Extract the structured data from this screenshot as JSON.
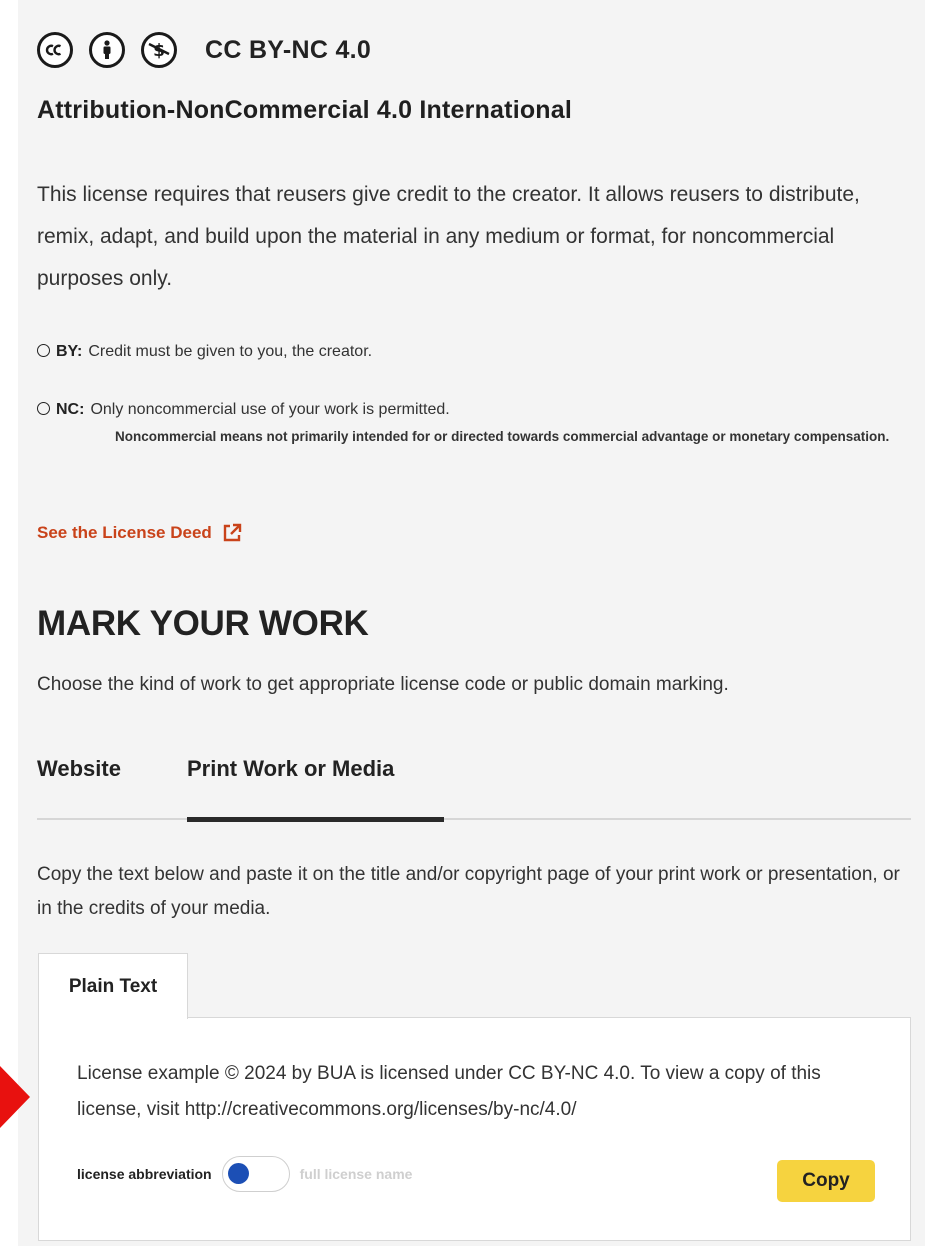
{
  "license": {
    "short_name": "CC BY-NC 4.0",
    "full_name": "Attribution-NonCommercial 4.0 International",
    "description": "This license requires that reusers give credit to the creator. It allows reusers to distribute, remix, adapt, and build upon the material in any medium or format, for noncommercial purposes only.",
    "icons": [
      "cc-icon",
      "by-person-icon",
      "nc-dollar-icon"
    ],
    "elements": [
      {
        "code": "BY:",
        "icon": "by-icon",
        "text": "Credit must be given to you, the creator.",
        "note": ""
      },
      {
        "code": "NC:",
        "icon": "nc-icon",
        "text": "Only noncommercial use of your work is permitted.",
        "note": "Noncommercial means not primarily intended for or directed towards commercial advantage or monetary compensation."
      }
    ],
    "deed_link": "See the License Deed"
  },
  "mark": {
    "title": "MARK YOUR WORK",
    "subtitle": "Choose the kind of work to get appropriate license code or public domain marking.",
    "tabs": [
      {
        "label": "Website",
        "active": false
      },
      {
        "label": "Print Work or Media",
        "active": true
      }
    ],
    "instructions": "Copy the text below and paste it on the title and/or copyright page of your print work or presentation, or in the credits of your media.",
    "format_tab": "Plain Text",
    "attribution_text": "License example © 2024 by BUA is licensed under CC BY-NC 4.0. To view a copy of this license, visit http://creativecommons.org/licenses/by-nc/4.0/",
    "toggle": {
      "left_label": "license abbreviation",
      "right_label": "full license name",
      "state": "abbreviation"
    },
    "copy_label": "Copy"
  },
  "colors": {
    "accent_link": "#c9431a",
    "copy_button": "#f6d33f",
    "toggle_knob": "#1c4fb5",
    "arrow": "#e8110f",
    "panel_bg": "#f4f4f4"
  }
}
